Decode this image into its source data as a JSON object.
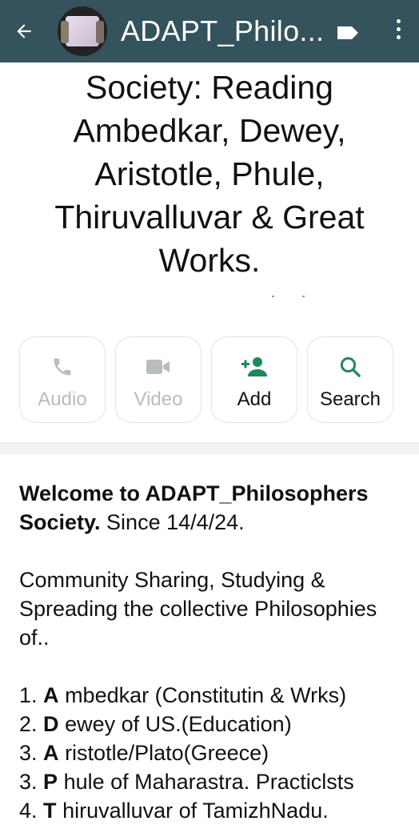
{
  "header": {
    "title": "ADAPT_Philo...",
    "back_icon": "arrow-left-icon",
    "menu_icon": "more-vertical-icon",
    "bg_color": "#34535c"
  },
  "group": {
    "description_lines": [
      "Society: Reading",
      "Ambedkar, Dewey,",
      "Aristotle, Phule,",
      "Thiruvalluvar & Great",
      "Works."
    ]
  },
  "actions": [
    {
      "label": "Audio",
      "icon": "phone-icon",
      "enabled": false
    },
    {
      "label": "Video",
      "icon": "video-camera-icon",
      "enabled": false
    },
    {
      "label": "Add",
      "icon": "add-person-icon",
      "enabled": true
    },
    {
      "label": "Search",
      "icon": "search-icon",
      "enabled": true
    }
  ],
  "about": {
    "welcome_bold": "Welcome to ADAPT_Philosophers Society.",
    "since": " Since 14/4/24.",
    "paragraph2": "Community Sharing, Studying & Spreading the collective Philosophies of..",
    "list": [
      {
        "num": "1.",
        "initial": "A",
        "rest": "mbedkar (Constitutin & Wrks)"
      },
      {
        "num": "2.",
        "initial": "D",
        "rest": "ewey of US.(Education)"
      },
      {
        "num": "3.",
        "initial": "A",
        "rest": "ristotle/Plato(Greece)"
      },
      {
        "num": "3.",
        "initial": "P",
        "rest": "hule of Maharastra. Practiclsts"
      },
      {
        "num": "4.",
        "initial": "T",
        "rest": "hiruvalluvar of TamizhNadu."
      }
    ]
  },
  "colors": {
    "accent_green": "#1d8a5a",
    "disabled_gray": "#b7bcbf"
  }
}
